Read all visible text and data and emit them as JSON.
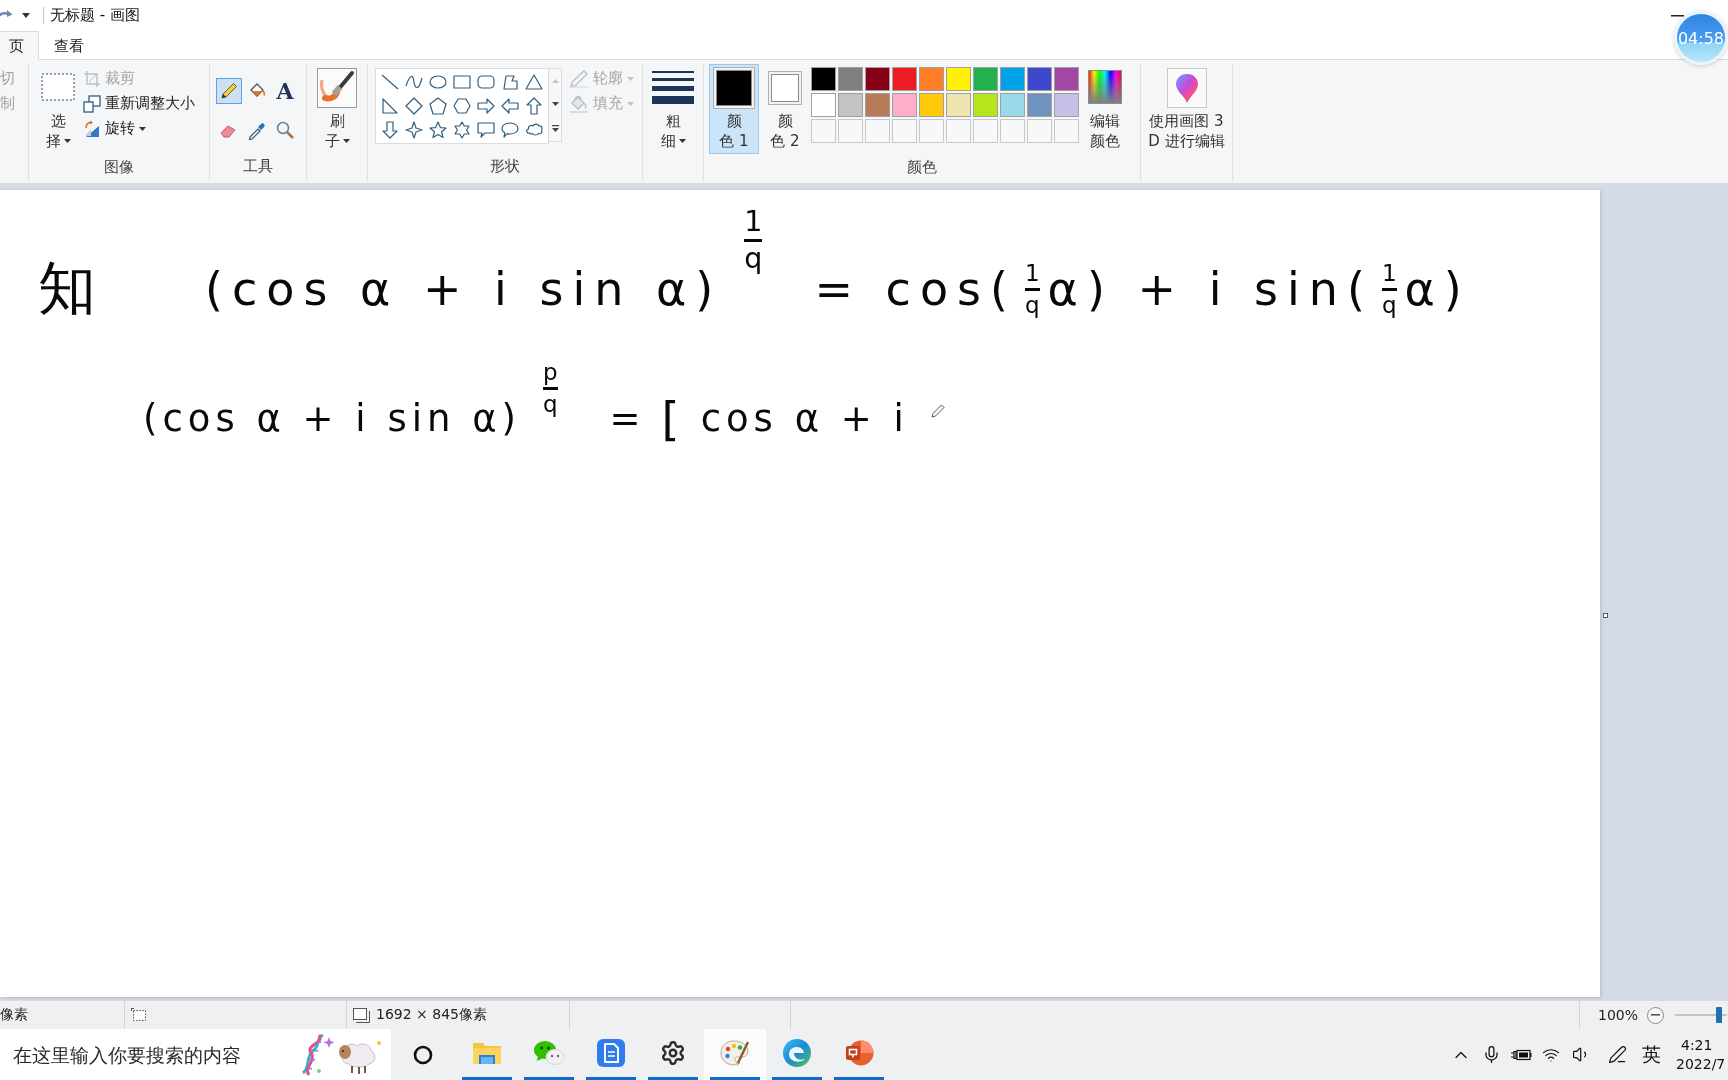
{
  "window": {
    "title": "无标题 - 画图",
    "timer": "04:58"
  },
  "ribbon_tabs": [
    {
      "label": "页",
      "selected": true
    },
    {
      "label": "查看",
      "selected": false
    }
  ],
  "ribbon": {
    "clipboard": [
      {
        "label": "切",
        "disabled": true
      },
      {
        "label": "制",
        "disabled": true
      }
    ],
    "image": {
      "label": "图像",
      "select": {
        "lines": [
          "选",
          "择"
        ]
      },
      "commands": [
        {
          "kind": "crop",
          "label": "裁剪",
          "disabled": true
        },
        {
          "kind": "resize",
          "label": "重新调整大小",
          "disabled": false
        },
        {
          "kind": "rotate",
          "label": "旋转",
          "disabled": false
        }
      ]
    },
    "tools": {
      "label": "工具",
      "items": [
        {
          "kind": "pencil",
          "selected": true
        },
        {
          "kind": "fill",
          "selected": false
        },
        {
          "kind": "text",
          "glyph": "A",
          "selected": false
        },
        {
          "kind": "eraser",
          "selected": false
        },
        {
          "kind": "picker",
          "selected": false
        },
        {
          "kind": "magnifier",
          "selected": false
        }
      ]
    },
    "brush": {
      "lines": [
        "刷",
        "子"
      ]
    },
    "shapes": {
      "label": "形状",
      "outline": {
        "label": "轮廓",
        "disabled": true
      },
      "fill": {
        "label": "填充",
        "disabled": true
      }
    },
    "thickness": {
      "lines": [
        "粗",
        "细"
      ]
    },
    "colors": {
      "label": "颜色",
      "slots": [
        {
          "lines": [
            "颜",
            "色 1"
          ],
          "color": "#000000",
          "selected": true
        },
        {
          "lines": [
            "颜",
            "色 2"
          ],
          "color": "#ffffff",
          "selected": false
        }
      ],
      "palette": [
        {
          "swatches": [
            {
              "color": "#000000"
            },
            {
              "color": "#7f7f7f"
            },
            {
              "color": "#880015"
            },
            {
              "color": "#ed1c24"
            },
            {
              "color": "#ff7f27"
            },
            {
              "color": "#fff200"
            },
            {
              "color": "#22b14c"
            },
            {
              "color": "#00a2e8"
            },
            {
              "color": "#3f48cc"
            },
            {
              "color": "#a349a4"
            }
          ]
        },
        {
          "swatches": [
            {
              "color": "#ffffff"
            },
            {
              "color": "#c3c3c3"
            },
            {
              "color": "#b97a57"
            },
            {
              "color": "#ffaec9"
            },
            {
              "color": "#ffc90e"
            },
            {
              "color": "#efe4b0"
            },
            {
              "color": "#b5e61d"
            },
            {
              "color": "#99d9ea"
            },
            {
              "color": "#7092be"
            },
            {
              "color": "#c8bfe7"
            }
          ]
        }
      ],
      "edit": {
        "lines": [
          "编辑",
          "颜色"
        ]
      }
    },
    "paint3d": {
      "lines": [
        "使用画图 3",
        "D 进行编辑"
      ]
    }
  },
  "canvas": {
    "lines": [
      {
        "segments": [
          {
            "kind": "big",
            "text": "知"
          },
          {
            "kind": "text",
            "text": "(cos α + i sin α)"
          },
          {
            "kind": "exponent",
            "numerator": "1",
            "denominator": "q"
          },
          {
            "kind": "text",
            "text": "= cos("
          },
          {
            "kind": "fraction",
            "numerator": "1",
            "denominator": "q"
          },
          {
            "kind": "text",
            "text": "α) + i sin("
          },
          {
            "kind": "fraction",
            "numerator": "1",
            "denominator": "q"
          },
          {
            "kind": "text",
            "text": "α)"
          }
        ]
      },
      {
        "segments": [
          {
            "kind": "text",
            "text": "(cos α + i sin α)"
          },
          {
            "kind": "exponent",
            "numerator": "p",
            "denominator": "q"
          },
          {
            "kind": "text",
            "text": "="
          },
          {
            "kind": "big",
            "text": "["
          },
          {
            "kind": "text",
            "text": "cos α + i"
          }
        ]
      }
    ]
  },
  "status_bar": {
    "cursor": "像素",
    "canvas_size": "1692 × 845像素",
    "zoom": "100%",
    "zoom_slider": {
      "level": 0.85
    }
  },
  "taskbar": {
    "search": {
      "placeholder": "在这里输入你要搜索的内容"
    },
    "apps": [
      {
        "kind": "explorer",
        "running": true,
        "selected": false
      },
      {
        "kind": "chat",
        "running": true,
        "selected": false
      },
      {
        "kind": "writer",
        "running": true,
        "selected": false
      },
      {
        "kind": "settings",
        "running": true,
        "selected": false
      },
      {
        "kind": "paint",
        "running": true,
        "selected": true
      },
      {
        "kind": "browser",
        "running": true,
        "selected": false
      },
      {
        "kind": "slides",
        "running": true,
        "selected": false
      }
    ],
    "language": "英",
    "clock": {
      "time": "4:21",
      "date": "2022/7"
    }
  }
}
